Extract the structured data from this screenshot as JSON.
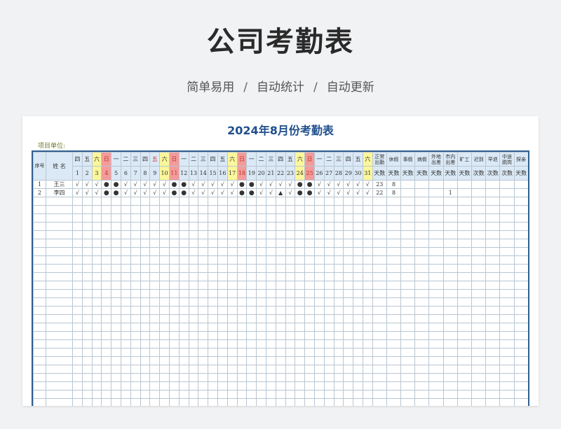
{
  "page": {
    "title": "公司考勤表",
    "features": [
      "简单易用",
      "自动统计",
      "自动更新"
    ],
    "separator": "/"
  },
  "sheet": {
    "title": "2024年8月份考勤表",
    "unit_label": "项目单位:"
  },
  "header": {
    "seq": "序号",
    "name": "姓 名",
    "weekdays": [
      "四",
      "五",
      "六",
      "日",
      "一",
      "二",
      "三",
      "四",
      "五",
      "六",
      "日",
      "一",
      "二",
      "三",
      "四",
      "五",
      "六",
      "日",
      "一",
      "二",
      "三",
      "四",
      "五",
      "六",
      "日",
      "一",
      "二",
      "三",
      "四",
      "五",
      "六"
    ],
    "days": [
      "1",
      "2",
      "3",
      "4",
      "5",
      "6",
      "7",
      "8",
      "9",
      "10",
      "11",
      "12",
      "13",
      "14",
      "15",
      "16",
      "17",
      "18",
      "19",
      "20",
      "21",
      "22",
      "23",
      "24",
      "25",
      "26",
      "27",
      "28",
      "29",
      "30",
      "31"
    ],
    "stats": [
      "正常出勤",
      "休假",
      "事假",
      "病假",
      "外地出差",
      "市内出差",
      "旷工",
      "迟到",
      "早退",
      "中途脱岗",
      "探亲"
    ],
    "stat_units": [
      "天数",
      "天数",
      "天数",
      "天数",
      "天数",
      "天数",
      "天数",
      "次数",
      "次数",
      "次数",
      "天数"
    ]
  },
  "rows": [
    {
      "seq": "1",
      "name": "王三",
      "marks": [
        "√",
        "√",
        "√",
        "●",
        "●",
        "√",
        "√",
        "√",
        "√",
        "√",
        "●",
        "●",
        "√",
        "√",
        "√",
        "√",
        "√",
        "●",
        "●",
        "√",
        "√",
        "√",
        "√",
        "●",
        "●",
        "√",
        "√",
        "√",
        "√",
        "√",
        "√"
      ],
      "stats": [
        "23",
        "8",
        "",
        "",
        "",
        "",
        "",
        "",
        "",
        "",
        ""
      ]
    },
    {
      "seq": "2",
      "name": "李四",
      "marks": [
        "√",
        "√",
        "√",
        "●",
        "●",
        "√",
        "√",
        "√",
        "√",
        "√",
        "●",
        "●",
        "√",
        "√",
        "√",
        "√",
        "√",
        "●",
        "●",
        "√",
        "√",
        "▲",
        "√",
        "●",
        "●",
        "√",
        "√",
        "√",
        "√",
        "√",
        "√"
      ],
      "stats": [
        "22",
        "8",
        "",
        "",
        "",
        "1",
        "",
        "",
        "",
        "",
        ""
      ]
    }
  ],
  "colors": {
    "title_blue": "#1f4e8c",
    "header_bg": "#dbe9f6",
    "saturday": "#fbf79a",
    "sunday": "#f39b9b",
    "border": "#2f5f8f"
  }
}
